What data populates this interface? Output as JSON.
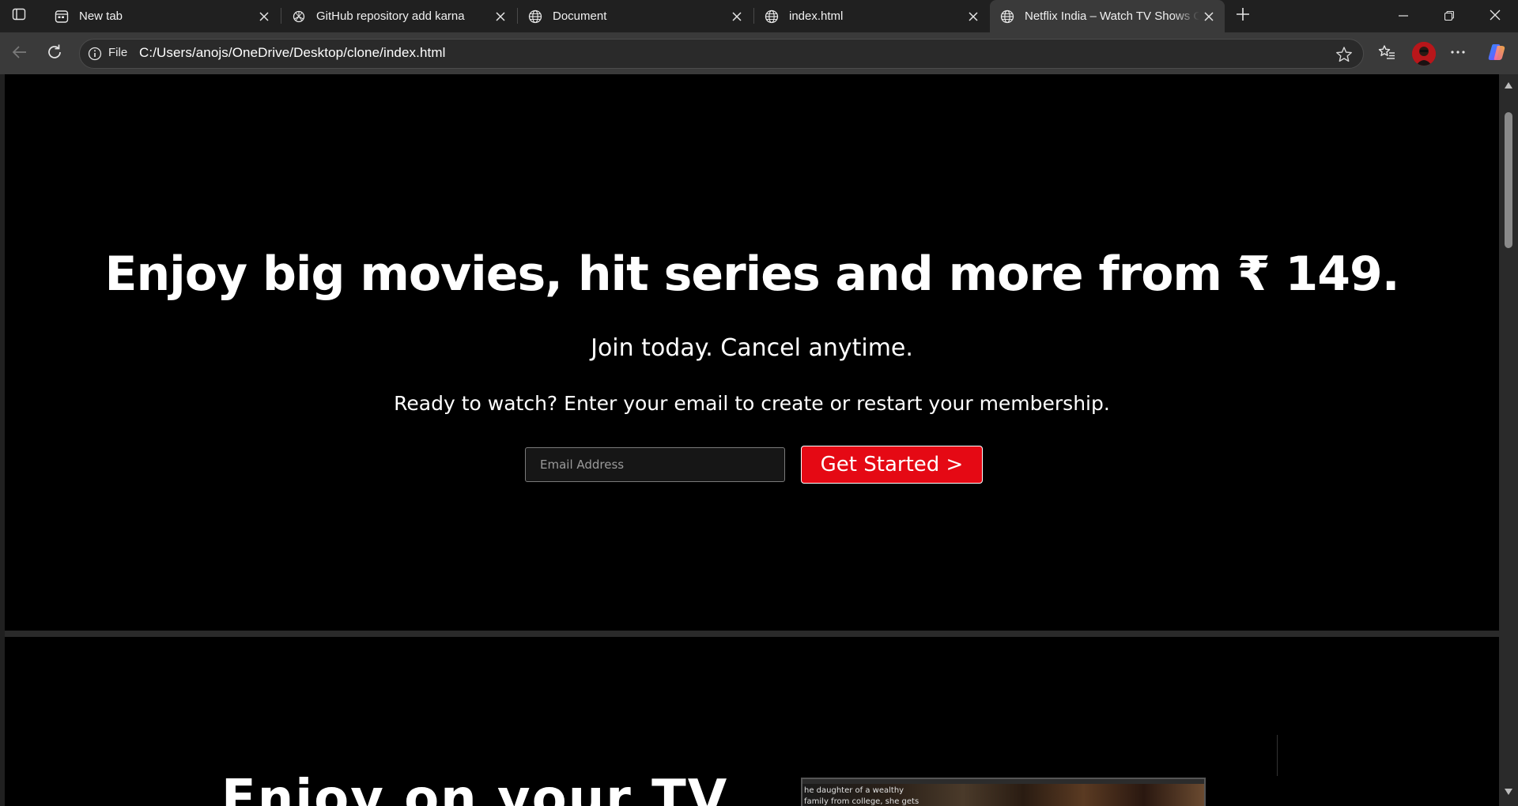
{
  "browser": {
    "tabs": [
      {
        "title": "New tab",
        "icon": "new-tab-page-icon",
        "active": false
      },
      {
        "title": "GitHub repository add karna",
        "icon": "chatgpt-icon",
        "active": false
      },
      {
        "title": "Document",
        "icon": "globe-icon",
        "active": false
      },
      {
        "title": "index.html",
        "icon": "globe-icon",
        "active": false
      },
      {
        "title": "Netflix India – Watch TV Shows Online",
        "icon": "globe-icon",
        "active": true
      }
    ],
    "address_bar": {
      "scheme_label": "File",
      "url": "C:/Users/anojs/OneDrive/Desktop/clone/index.html"
    },
    "accent_color": "#e50914"
  },
  "page": {
    "hero": {
      "heading": "Enjoy big movies, hit series and more from ₹ 149.",
      "subheading": "Join today. Cancel anytime.",
      "prompt": "Ready to watch? Enter your email to create or restart your membership.",
      "email_placeholder": "Email Address",
      "cta_label": "Get Started >"
    },
    "section2": {
      "heading_partial": "Enjoy on your TV",
      "image_caption": "he daughter of a wealthy family from college, she gets a frosty e from her brother, who has s -- and plans -- of his own."
    }
  }
}
